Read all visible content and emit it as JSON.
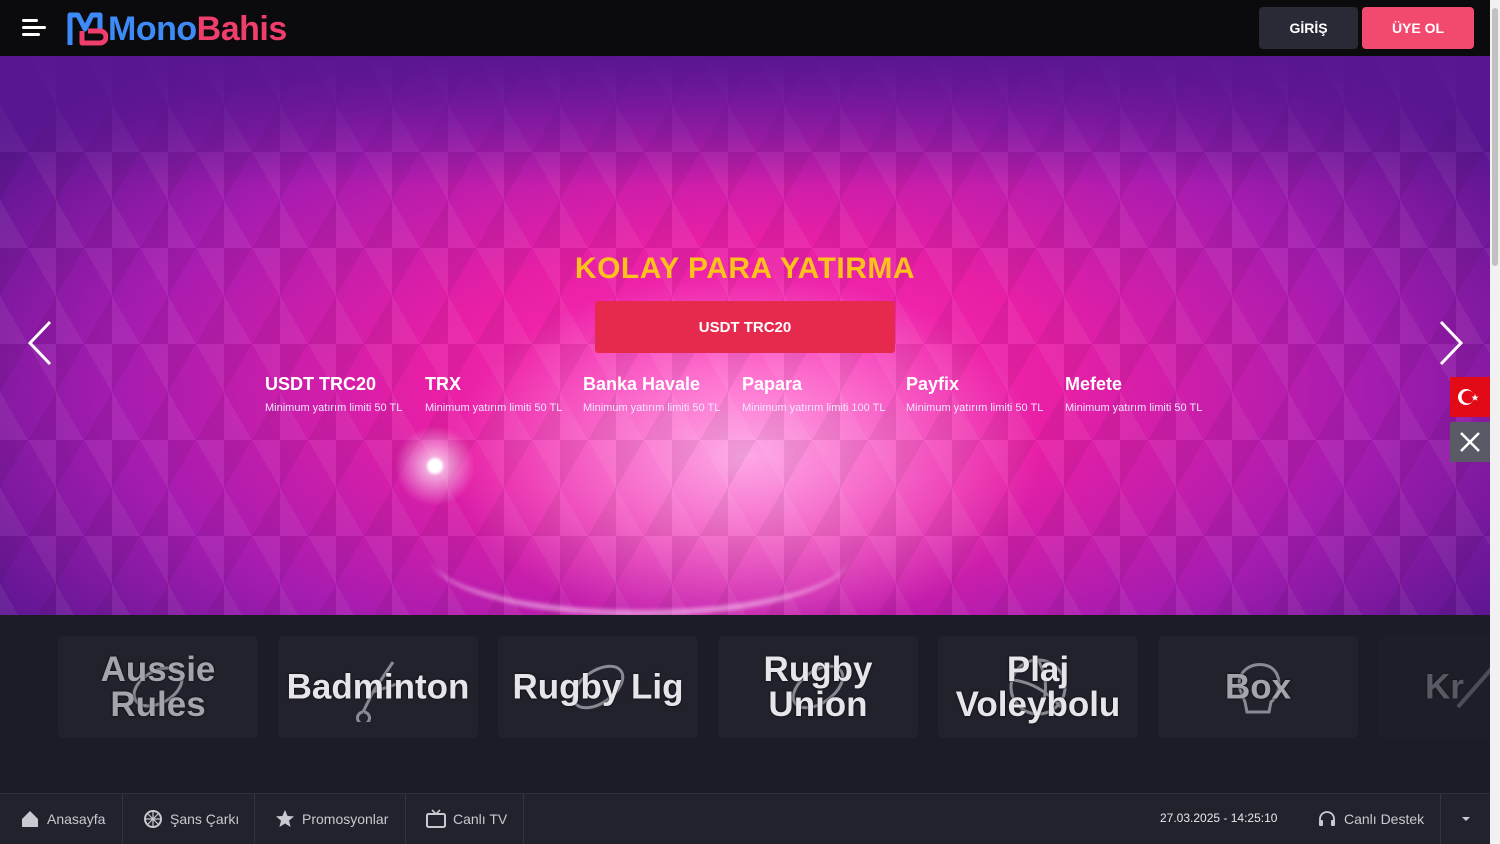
{
  "header": {
    "logo_part1": "Mono",
    "logo_part2": "Bahis",
    "login_label": "GİRİŞ",
    "register_label": "ÜYE OL"
  },
  "banner": {
    "title": "KOLAY PARA YATIRMA",
    "button_label": "USDT TRC20",
    "methods": [
      {
        "name": "USDT TRC20",
        "limit": "Minimum yatırım limiti 50 TL"
      },
      {
        "name": "TRX",
        "limit": "Minimum yatırım limiti 50 TL"
      },
      {
        "name": "Banka Havale",
        "limit": "Minimum yatırım limiti 50 TL"
      },
      {
        "name": "Papara",
        "limit": "Minimum yatırım limiti 100 TL"
      },
      {
        "name": "Payfix",
        "limit": "Minimum yatırım limiti 50 TL"
      },
      {
        "name": "Mefete",
        "limit": "Minimum yatırım limiti 50 TL"
      }
    ]
  },
  "sports": [
    {
      "label": "Aussie Rules",
      "icon": "aussie-rules-icon"
    },
    {
      "label": "Badminton",
      "icon": "shuttlecock-icon"
    },
    {
      "label": "Rugby Lig",
      "icon": "rugby-ball-icon"
    },
    {
      "label": "Rugby Union",
      "icon": "rugby-ball-icon"
    },
    {
      "label": "Plaj Voleybolu",
      "icon": "volleyball-icon"
    },
    {
      "label": "Box",
      "icon": "boxing-glove-icon"
    },
    {
      "label": "Kr",
      "icon": "cricket-icon"
    }
  ],
  "bottom_bar": {
    "home": "Anasayfa",
    "wheel": "Şans Çarkı",
    "promotions": "Promosyonlar",
    "live_tv": "Canlı TV",
    "datetime": "27.03.2025 - 14:25:10",
    "support": "Canlı Destek"
  },
  "colors": {
    "brand_blue": "#3d8bf7",
    "brand_pink": "#ef3d6c",
    "register_bg": "#f24a6e",
    "cta_red": "#e52a4e",
    "title_yellow": "#ffc21a"
  }
}
